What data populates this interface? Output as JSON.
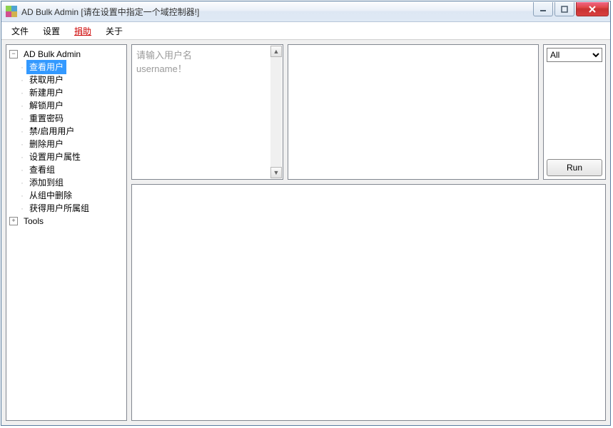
{
  "window": {
    "title": "AD Bulk Admin [请在设置中指定一个域控制器!]"
  },
  "menu": {
    "file": "文件",
    "settings": "设置",
    "donate": "捐助",
    "about": "关于"
  },
  "tree": {
    "root_label": "AD Bulk Admin",
    "items": [
      "查看用户",
      "获取用户",
      "新建用户",
      "解锁用户",
      "重置密码",
      "禁/启用用户",
      "删除用户",
      "设置用户属性",
      "查看组",
      "添加到组",
      "从组中删除",
      "获得用户所属组"
    ],
    "tools_label": "Tools",
    "selected_index": 0
  },
  "input": {
    "placeholder": "请输入用户名\nusername！"
  },
  "action": {
    "dropdown_value": "All",
    "run_label": "Run"
  }
}
